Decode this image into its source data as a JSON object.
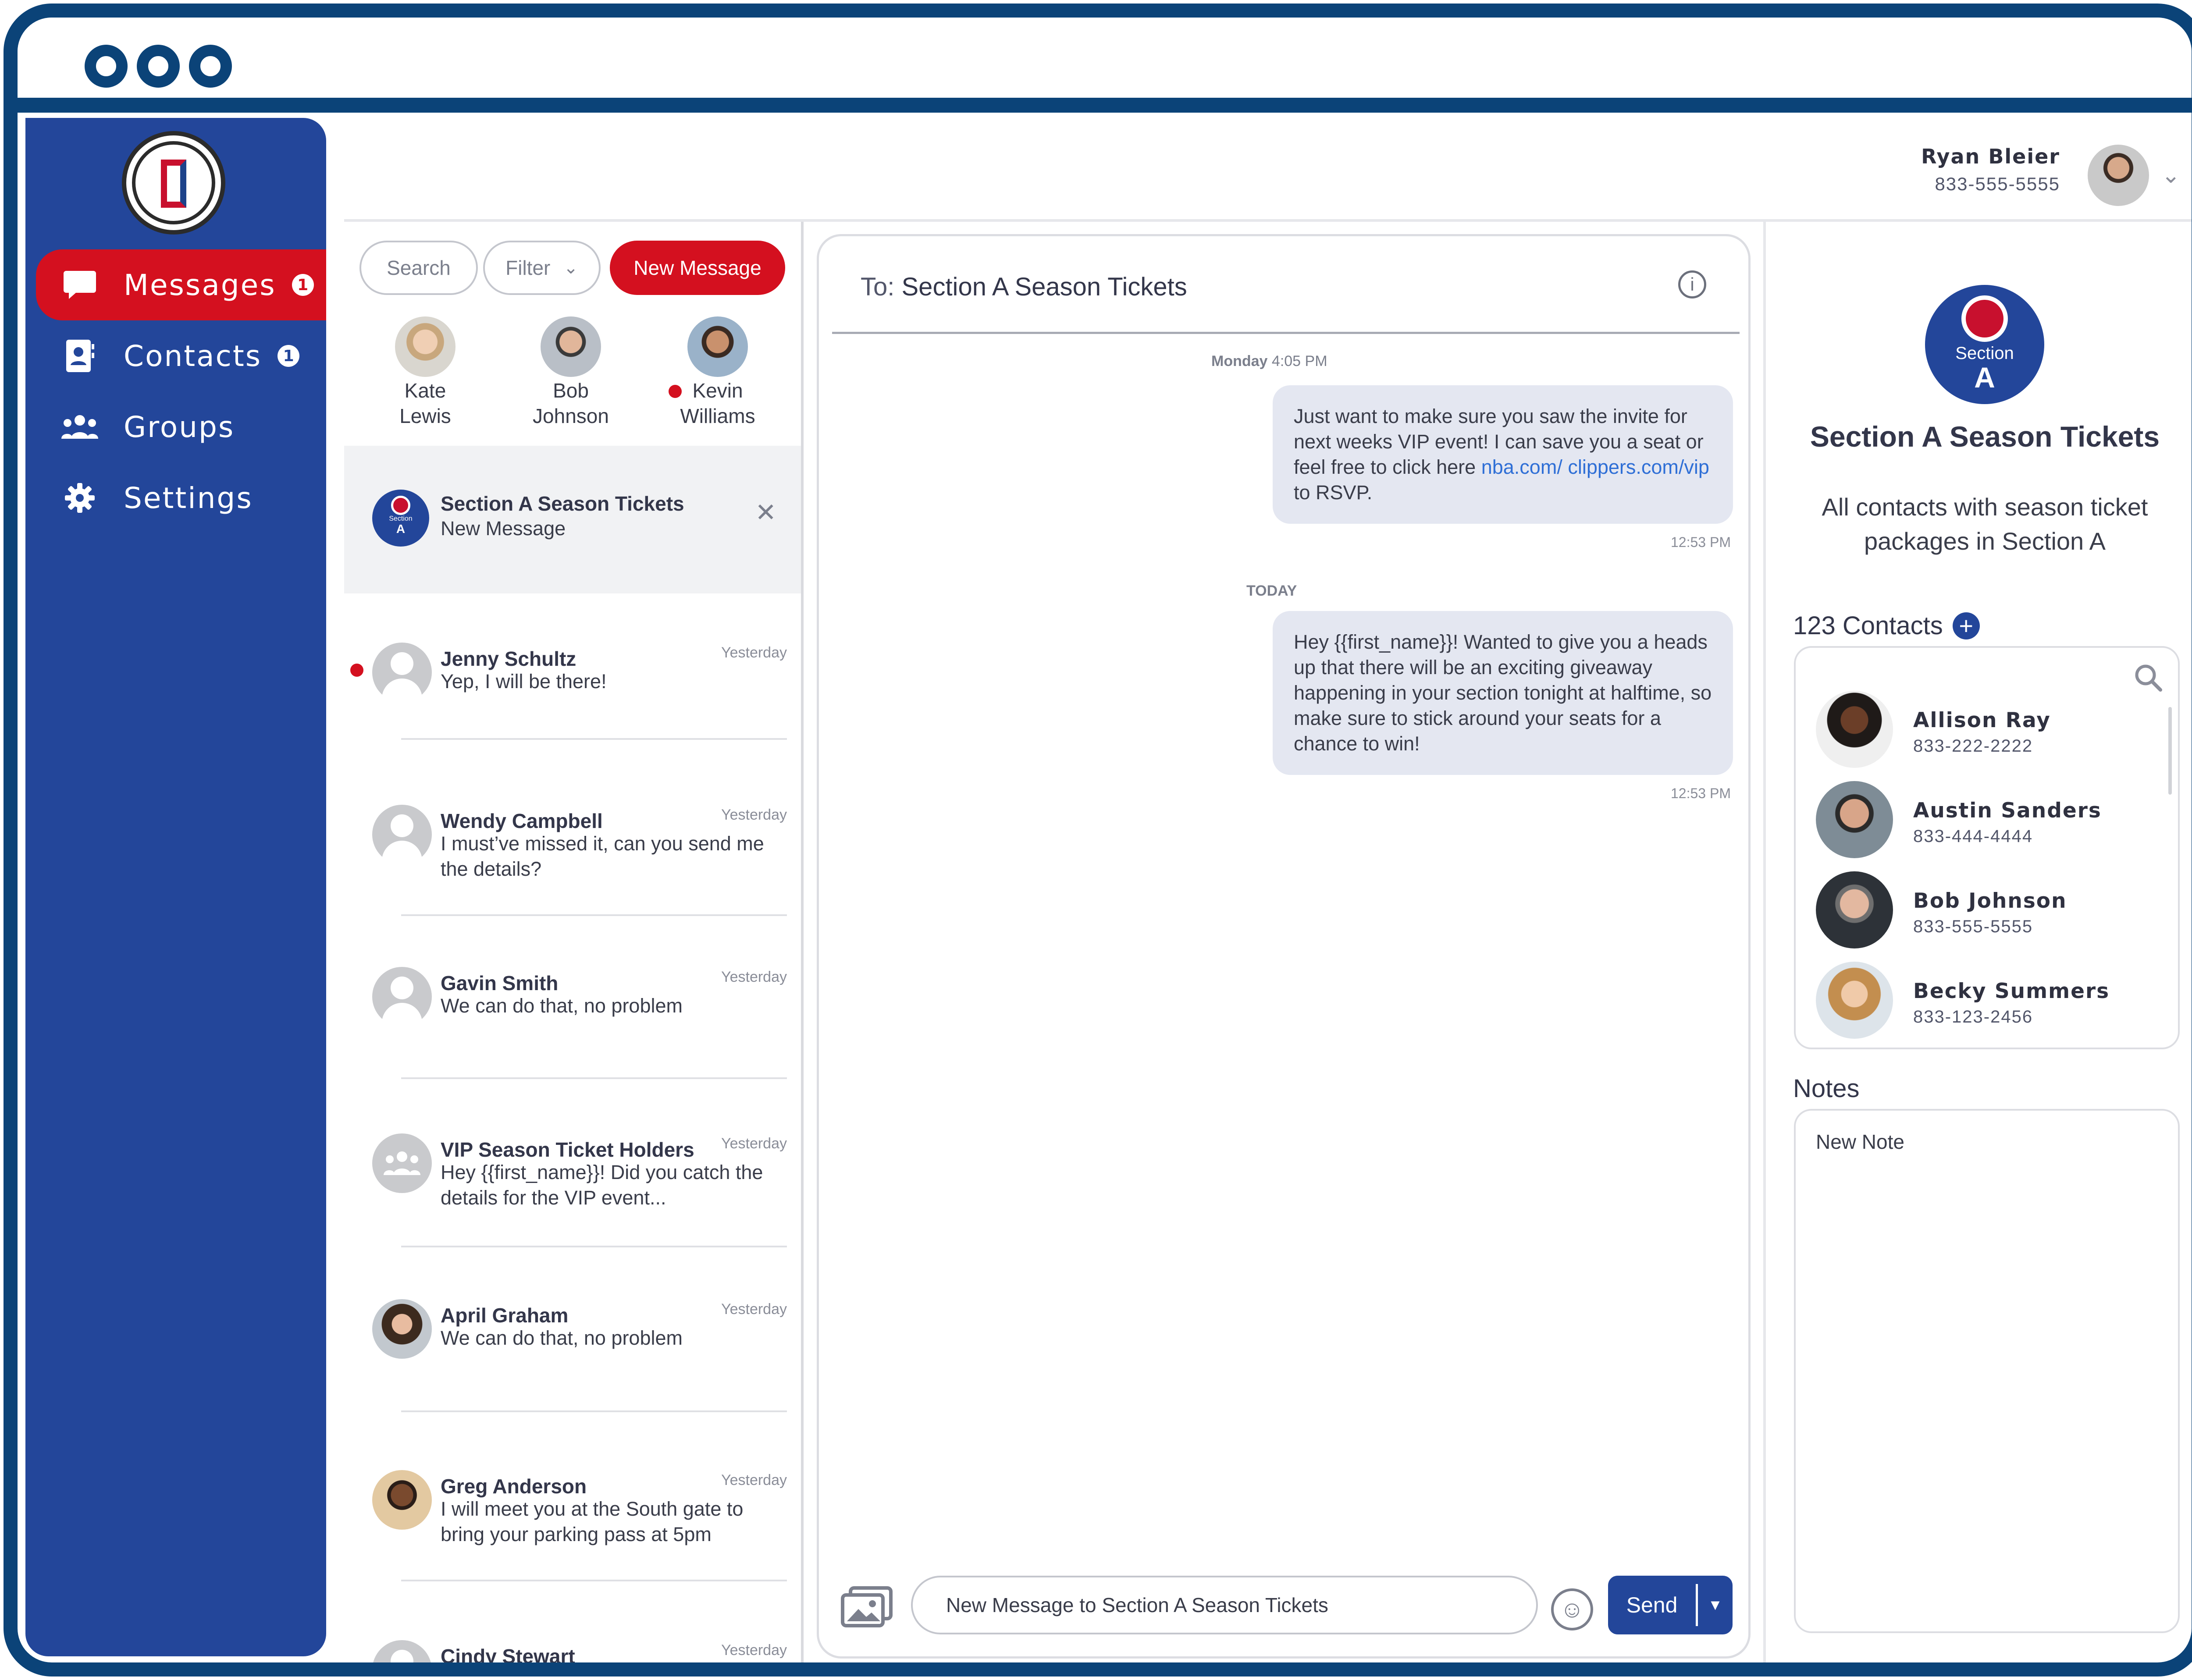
{
  "window": {
    "controls": [
      "dot",
      "dot",
      "dot"
    ]
  },
  "sidebar": {
    "logo": "clippers-logo",
    "items": [
      {
        "label": "Messages",
        "icon": "chat-bubble-icon",
        "badge": "1",
        "active": true
      },
      {
        "label": "Contacts",
        "icon": "address-book-icon",
        "badge": "1",
        "active": false
      },
      {
        "label": "Groups",
        "icon": "people-icon",
        "badge": null,
        "active": false
      },
      {
        "label": "Settings",
        "icon": "gear-icon",
        "badge": null,
        "active": false
      }
    ]
  },
  "header": {
    "user_name": "Ryan Bleier",
    "user_phone": "833-555-5555"
  },
  "list": {
    "search_placeholder": "Search",
    "filter_label": "Filter",
    "new_message_label": "New Message",
    "favorites": [
      {
        "first": "Kate",
        "last": "Lewis",
        "online": false
      },
      {
        "first": "Bob",
        "last": "Johnson",
        "online": false
      },
      {
        "first": "Kevin",
        "last": "Williams",
        "online": true
      }
    ],
    "conversations": [
      {
        "title": "Section A Season Tickets",
        "preview": "New Message",
        "time": "",
        "unread": false,
        "active": true
      },
      {
        "title": "Jenny Schultz",
        "preview": "Yep, I will be there!",
        "time": "Yesterday",
        "unread": true
      },
      {
        "title": "Wendy Campbell",
        "preview": "I must’ve missed it, can you send me the details?",
        "time": "Yesterday",
        "unread": false
      },
      {
        "title": "Gavin Smith",
        "preview": "We can do that, no problem",
        "time": "Yesterday",
        "unread": false
      },
      {
        "title": "VIP Season Ticket Holders",
        "preview": "Hey {{first_name}}! Did you catch the details for the VIP event...",
        "time": "Yesterday",
        "unread": false
      },
      {
        "title": "April Graham",
        "preview": "We can do that, no problem",
        "time": "Yesterday",
        "unread": false
      },
      {
        "title": "Greg Anderson",
        "preview": "I will meet you at the South gate to bring your parking pass at 5pm",
        "time": "Yesterday",
        "unread": false
      },
      {
        "title": "Cindy Stewart",
        "preview": "",
        "time": "Yesterday",
        "unread": false
      }
    ]
  },
  "chat": {
    "to_prefix": "To:",
    "to_name": "Section A Season Tickets",
    "stamp1_day": "Monday",
    "stamp1_time": "4:05 PM",
    "message1_text": "Just want to make sure you saw the invite for next weeks VIP event! I can save you a seat or feel free to click here",
    "message1_link": "nba.com/ clippers.com/vip",
    "message1_suffix": "to RSVP.",
    "message1_time": "12:53 PM",
    "stamp2": "TODAY",
    "message2_text": "Hey {{first_name}}! Wanted to give you a heads up that there will be an exciting giveaway happening in your section tonight at halftime, so make sure to stick around your seats for a chance to win!",
    "message2_time": "12:53 PM",
    "composer_placeholder": "New Message to Section A Season Tickets",
    "send_label": "Send"
  },
  "group": {
    "badge_small": "Section",
    "badge_letter": "A",
    "title": "Section A Season Tickets",
    "description": "All contacts with season ticket packages in Section A",
    "contacts_count_label": "123 Contacts",
    "contacts": [
      {
        "name": "Allison Ray",
        "phone": "833-222-2222"
      },
      {
        "name": "Austin Sanders",
        "phone": "833-444-4444"
      },
      {
        "name": "Bob Johnson",
        "phone": "833-555-5555"
      },
      {
        "name": "Becky Summers",
        "phone": "833-123-2456"
      }
    ],
    "notes_label": "Notes",
    "notes_placeholder": "New Note"
  },
  "colors": {
    "brand_blue": "#23469a",
    "frame_navy": "#0b4378",
    "accent_red": "#d4101f"
  }
}
